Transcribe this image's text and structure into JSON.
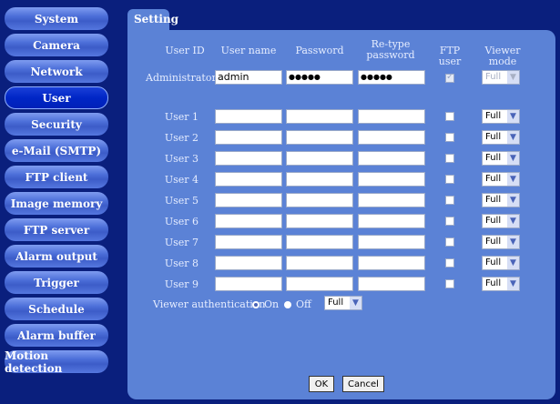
{
  "sidebar": {
    "items": [
      {
        "label": "System"
      },
      {
        "label": "Camera"
      },
      {
        "label": "Network"
      },
      {
        "label": "User",
        "active": true
      },
      {
        "label": "Security"
      },
      {
        "label": "e-Mail (SMTP)"
      },
      {
        "label": "FTP client"
      },
      {
        "label": "Image memory"
      },
      {
        "label": "FTP server"
      },
      {
        "label": "Alarm output"
      },
      {
        "label": "Trigger"
      },
      {
        "label": "Schedule"
      },
      {
        "label": "Alarm buffer"
      },
      {
        "label": "Motion detection"
      }
    ]
  },
  "tab": {
    "label": "Setting"
  },
  "headers": {
    "user_id": "User ID",
    "user_name": "User name",
    "password": "Password",
    "retype": "Re-type password",
    "ftp_user": "FTP user",
    "viewer_mode": "Viewer mode"
  },
  "admin": {
    "label": "Administrator",
    "user_name": "admin",
    "password": "●●●●●",
    "retype": "●●●●●",
    "ftp_user": true,
    "viewer_mode": "Full"
  },
  "users": [
    {
      "label": "User 1",
      "viewer_mode": "Full"
    },
    {
      "label": "User 2",
      "viewer_mode": "Full"
    },
    {
      "label": "User 3",
      "viewer_mode": "Full"
    },
    {
      "label": "User 4",
      "viewer_mode": "Full"
    },
    {
      "label": "User 5",
      "viewer_mode": "Full"
    },
    {
      "label": "User 6",
      "viewer_mode": "Full"
    },
    {
      "label": "User 7",
      "viewer_mode": "Full"
    },
    {
      "label": "User 8",
      "viewer_mode": "Full"
    },
    {
      "label": "User 9",
      "viewer_mode": "Full"
    }
  ],
  "viewer_auth": {
    "label": "Viewer authentication",
    "on_label": "On",
    "off_label": "Off",
    "selected": "On",
    "mode": "Full"
  },
  "buttons": {
    "ok": "OK",
    "cancel": "Cancel"
  },
  "colors": {
    "background": "#0a1f7d",
    "panel": "#5b82d6",
    "active_item": "#0026c6"
  }
}
